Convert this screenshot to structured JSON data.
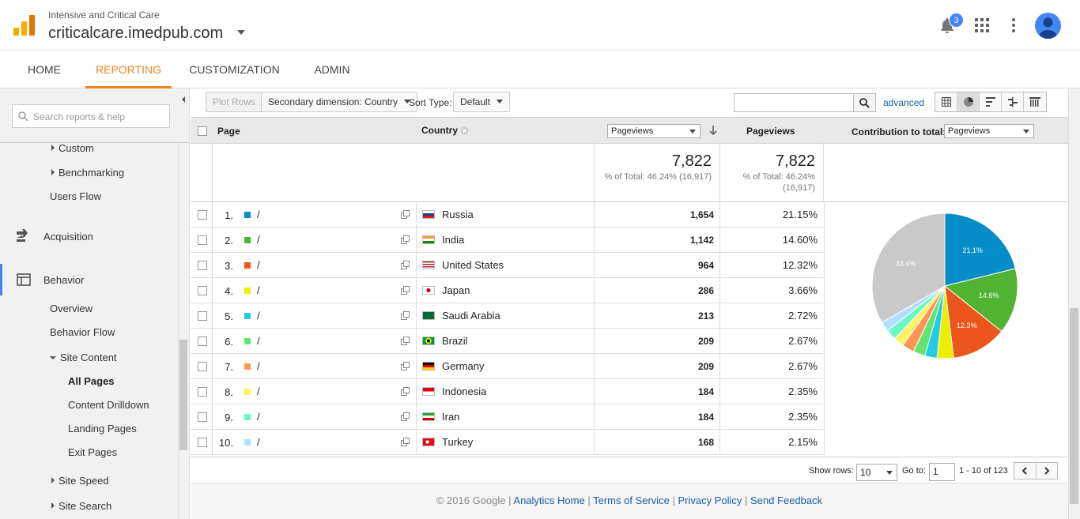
{
  "header": {
    "account_subtitle": "Intensive and Critical Care",
    "account_name": "criticalcare.imedpub.com",
    "notification_count": "3",
    "icons": [
      "analytics-logo-icon",
      "bell-icon",
      "apps-grid-icon",
      "more-vert-icon",
      "avatar-icon"
    ]
  },
  "nav": {
    "tabs": [
      {
        "label": "HOME"
      },
      {
        "label": "REPORTING"
      },
      {
        "label": "CUSTOMIZATION"
      },
      {
        "label": "ADMIN"
      }
    ],
    "active": "REPORTING"
  },
  "sidebar": {
    "search_placeholder": "Search reports & help",
    "items": [
      {
        "label": "Custom"
      },
      {
        "label": "Benchmarking"
      },
      {
        "label": "Users Flow"
      },
      {
        "label": "Acquisition"
      },
      {
        "label": "Behavior"
      },
      {
        "label": "Overview"
      },
      {
        "label": "Behavior Flow"
      },
      {
        "label": "Site Content"
      },
      {
        "label": "All Pages"
      },
      {
        "label": "Content Drilldown"
      },
      {
        "label": "Landing Pages"
      },
      {
        "label": "Exit Pages"
      },
      {
        "label": "Site Speed"
      },
      {
        "label": "Site Search"
      }
    ]
  },
  "toolbar": {
    "plot_rows": "Plot Rows",
    "secondary_dimension": "Secondary dimension: Country",
    "sort_type_label": "Sort Type:",
    "sort_type_value": "Default",
    "advanced": "advanced"
  },
  "table": {
    "headers": {
      "page": "Page",
      "country": "Country",
      "metric_select": "Pageviews",
      "pageviews": "Pageviews",
      "contribution_label": "Contribution to total:",
      "contribution_select": "Pageviews"
    },
    "totals": {
      "value1": "7,822",
      "sub1": "% of Total: 46.24% (16,917)",
      "value2": "7,822",
      "sub2a": "% of Total: 46.24%",
      "sub2b": "(16,917)"
    },
    "rows": [
      {
        "num": "1.",
        "page": "/",
        "country": "Russia",
        "pageviews": "1,654",
        "pct": "21.15%",
        "color": "#058dc7",
        "flag": "russia"
      },
      {
        "num": "2.",
        "page": "/",
        "country": "India",
        "pageviews": "1,142",
        "pct": "14.60%",
        "color": "#50b432",
        "flag": "india"
      },
      {
        "num": "3.",
        "page": "/",
        "country": "United States",
        "pageviews": "964",
        "pct": "12.32%",
        "color": "#ed561b",
        "flag": "us"
      },
      {
        "num": "4.",
        "page": "/",
        "country": "Japan",
        "pageviews": "286",
        "pct": "3.66%",
        "color": "#edef00",
        "flag": "japan"
      },
      {
        "num": "5.",
        "page": "/",
        "country": "Saudi Arabia",
        "pageviews": "213",
        "pct": "2.72%",
        "color": "#24cbe5",
        "flag": "saudi"
      },
      {
        "num": "6.",
        "page": "/",
        "country": "Brazil",
        "pageviews": "209",
        "pct": "2.67%",
        "color": "#64e572",
        "flag": "brazil"
      },
      {
        "num": "7.",
        "page": "/",
        "country": "Germany",
        "pageviews": "209",
        "pct": "2.67%",
        "color": "#ff9655",
        "flag": "germany"
      },
      {
        "num": "8.",
        "page": "/",
        "country": "Indonesia",
        "pageviews": "184",
        "pct": "2.35%",
        "color": "#fff263",
        "flag": "indonesia"
      },
      {
        "num": "9.",
        "page": "/",
        "country": "Iran",
        "pageviews": "184",
        "pct": "2.35%",
        "color": "#6af9c4",
        "flag": "iran"
      },
      {
        "num": "10.",
        "page": "/",
        "country": "Turkey",
        "pageviews": "168",
        "pct": "2.15%",
        "color": "#b2deff",
        "flag": "turkey"
      }
    ]
  },
  "pie": {
    "slices": [
      21.15,
      14.6,
      12.32,
      3.66,
      2.72,
      2.67,
      2.67,
      2.35,
      2.35,
      2.15,
      33.4
    ],
    "colors": [
      "#058dc7",
      "#50b432",
      "#ed561b",
      "#edef00",
      "#24cbe5",
      "#64e572",
      "#ff9655",
      "#fff263",
      "#6af9c4",
      "#b2deff",
      "#c9c9c9"
    ],
    "labels": [
      "21.1%",
      "14.6%",
      "12.3%",
      "",
      "",
      "",
      "",
      "",
      "",
      "",
      "33.4%"
    ]
  },
  "pager": {
    "show_rows_label": "Show rows:",
    "show_rows_value": "10",
    "goto_label": "Go to:",
    "goto_value": "1",
    "range": "1 - 10 of 123"
  },
  "footer": {
    "copyright": "© 2016 Google",
    "links": [
      "Analytics Home",
      "Terms of Service",
      "Privacy Policy",
      "Send Feedback"
    ]
  }
}
